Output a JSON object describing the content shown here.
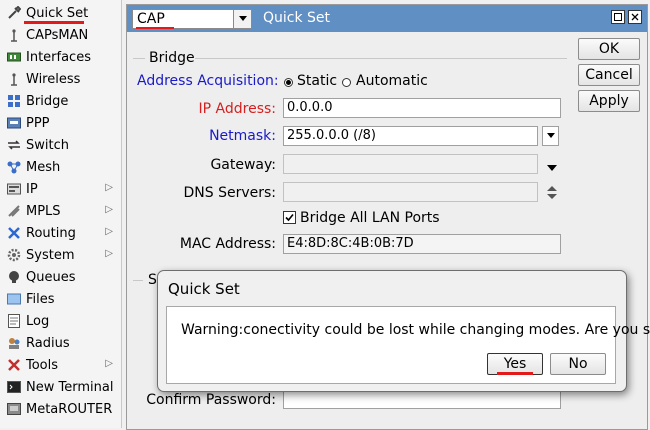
{
  "sidebar": {
    "items": [
      {
        "label": "Quick Set",
        "icon": "quick-set-icon",
        "submenu": false
      },
      {
        "label": "CAPsMAN",
        "icon": "capsman-icon",
        "submenu": false
      },
      {
        "label": "Interfaces",
        "icon": "interfaces-icon",
        "submenu": false
      },
      {
        "label": "Wireless",
        "icon": "wireless-icon",
        "submenu": false
      },
      {
        "label": "Bridge",
        "icon": "bridge-icon",
        "submenu": false
      },
      {
        "label": "PPP",
        "icon": "ppp-icon",
        "submenu": false
      },
      {
        "label": "Switch",
        "icon": "switch-icon",
        "submenu": false
      },
      {
        "label": "Mesh",
        "icon": "mesh-icon",
        "submenu": false
      },
      {
        "label": "IP",
        "icon": "ip-icon",
        "submenu": true
      },
      {
        "label": "MPLS",
        "icon": "mpls-icon",
        "submenu": true
      },
      {
        "label": "Routing",
        "icon": "routing-icon",
        "submenu": true
      },
      {
        "label": "System",
        "icon": "system-icon",
        "submenu": true
      },
      {
        "label": "Queues",
        "icon": "queues-icon",
        "submenu": false
      },
      {
        "label": "Files",
        "icon": "files-icon",
        "submenu": false
      },
      {
        "label": "Log",
        "icon": "log-icon",
        "submenu": false
      },
      {
        "label": "Radius",
        "icon": "radius-icon",
        "submenu": false
      },
      {
        "label": "Tools",
        "icon": "tools-icon",
        "submenu": true
      },
      {
        "label": "New Terminal",
        "icon": "terminal-icon",
        "submenu": false
      },
      {
        "label": "MetaROUTER",
        "icon": "metarouter-icon",
        "submenu": false
      }
    ]
  },
  "window": {
    "mode_value": "CAP",
    "title": "Quick Set",
    "ok_label": "OK",
    "cancel_label": "Cancel",
    "apply_label": "Apply"
  },
  "bridge": {
    "section_label": "Bridge",
    "address_acquisition_label": "Address Acquisition:",
    "static_label": "Static",
    "automatic_label": "Automatic",
    "ip_label": "IP Address:",
    "ip_value": "0.0.0.0",
    "netmask_label": "Netmask:",
    "netmask_value": "255.0.0.0 (/8)",
    "gateway_label": "Gateway:",
    "gateway_value": "",
    "dns_label": "DNS Servers:",
    "dns_value": "",
    "bridge_all_label": "Bridge All LAN Ports",
    "mac_label": "MAC Address:",
    "mac_value": "E4:8D:8C:4B:0B:7D"
  },
  "system": {
    "confirm_password_label": "Confirm Password:"
  },
  "dialog": {
    "title": "Quick Set",
    "message": "Warning:conectivity could be lost while changing modes. Are you sure?",
    "yes_label": "Yes",
    "no_label": "No"
  },
  "colors": {
    "titlebar": "#5f8fc3",
    "label_blue": "#1a1ac8",
    "label_red": "#d42020",
    "underline_red": "#e21a1a"
  }
}
